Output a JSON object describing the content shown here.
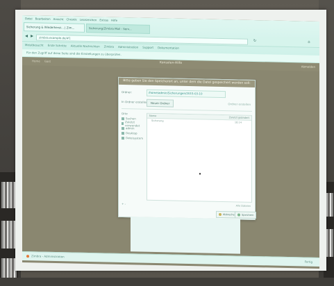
{
  "browser": {
    "menu": [
      "Datei",
      "Bearbeiten",
      "Ansicht",
      "Chronik",
      "Lesezeichen",
      "Extras",
      "Hilfe"
    ],
    "tabs": [
      {
        "label": "Sicherung & Wiederherst... | Zim..."
      },
      {
        "label": "Sicherung/Zimbra Mail - Serv..."
      }
    ],
    "url": "zimbra.example.de/#1",
    "bookmarks": [
      "Meistbesucht",
      "Erste Schritte",
      "Aktuelle Nachrichten",
      "Zimbra",
      "Administration",
      "Support",
      "Dokumentation"
    ],
    "notification": "Für den Zugriff auf diese Seite sind die Einstellungen zu überprüfen."
  },
  "app": {
    "left_items": [
      "Home",
      "Gast"
    ],
    "center_title": "Konsolen-Hilfe",
    "right_item": "Abmelden"
  },
  "dialog": {
    "header": "Bitte geben Sie den Speicherort an, unter dem die Datei gespeichert werden soll:",
    "folder_label": "Ordner:",
    "folder_value": "/home/admin/Sicherungen/2015-03-10",
    "create_label": "In Ordner erstellen:",
    "new_folder_button": "Neuer Ordner",
    "new_folder_right": "Ordner erstellen",
    "places_label": "Orte",
    "places": [
      {
        "label": "Suchen"
      },
      {
        "label": "Zuletzt verwendet"
      },
      {
        "label": "admin"
      },
      {
        "label": "Desktop"
      },
      {
        "label": "Dateisystem"
      }
    ],
    "col_name": "Name",
    "col_modified": "Zuletzt geändert",
    "files": [
      {
        "name": "Sicherung",
        "modified": "10:14"
      }
    ],
    "filter_label": "Alle Dateien",
    "add_label": "+ -",
    "cancel_button": "Abbrechen",
    "save_button": "Speichern"
  },
  "status": {
    "left": "Zimbra - Administration",
    "right": "Fertig"
  }
}
